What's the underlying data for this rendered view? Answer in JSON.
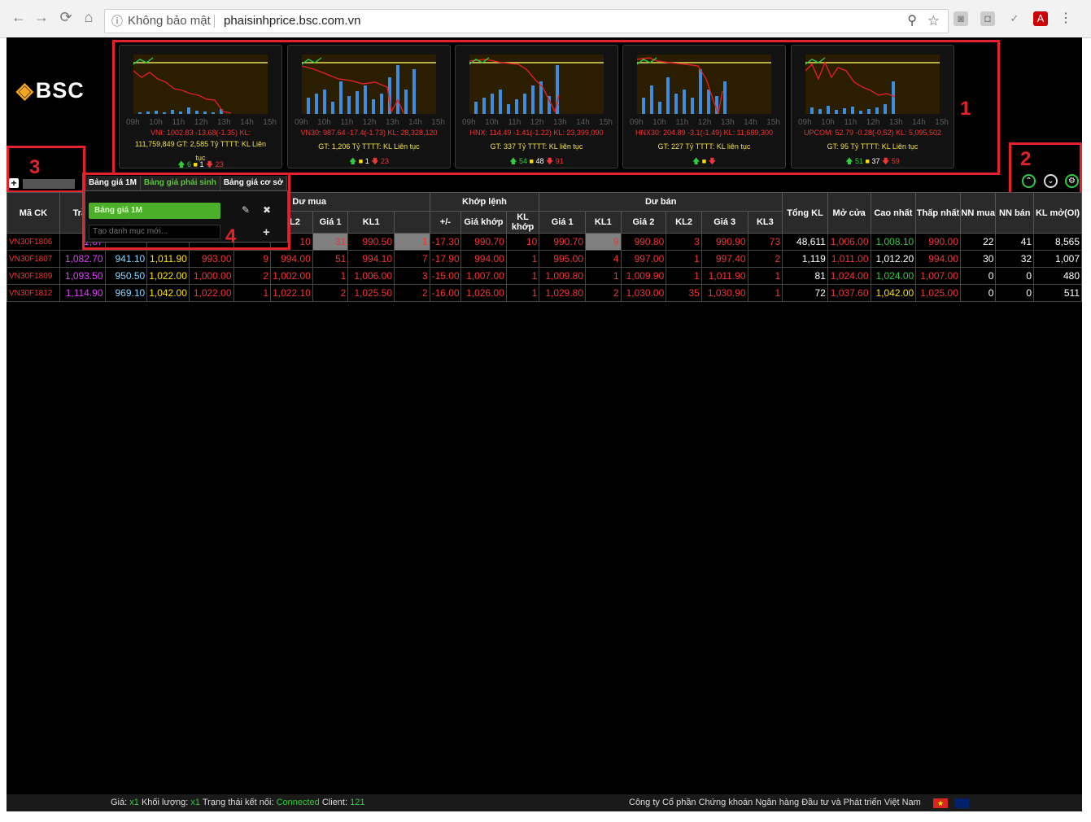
{
  "browser": {
    "insecure_label": "Không bảo mật",
    "url": "phaisinhprice.bsc.com.vn"
  },
  "logo": {
    "text": "BSC"
  },
  "time_axis": [
    "09h",
    "10h",
    "11h",
    "12h",
    "13h",
    "14h",
    "15h"
  ],
  "indices": [
    {
      "name": "VNI",
      "line1": "VNI: 1002.83 -13.68(-1.35) KL:",
      "line2": "111,759,849 GT: 2,585 Tỷ TTTT: KL Liên",
      "line2b": "tục",
      "up": "6",
      "ref": "1",
      "down": "23"
    },
    {
      "name": "VN30",
      "line1": "VN30: 987.64 -17.4(-1.73) KL: 28,328,120",
      "line2": "GT: 1,206 Tỷ TTTT: KL Liên tục",
      "line2b": "",
      "up": "",
      "ref": "1",
      "down": "23"
    },
    {
      "name": "HNX",
      "line1": "HNX: 114.49 -1.41(-1.22) KL: 23,399,090",
      "line2": "GT: 337 Tỷ TTTT: KL liên tục",
      "line2b": "",
      "up": "54",
      "ref": "48",
      "down": "91"
    },
    {
      "name": "HNX30",
      "line1": "HNX30: 204.89 -3.1(-1.49) KL: 11,689,300",
      "line2": "GT: 227 Tỷ TTTT: KL liên tục",
      "line2b": "",
      "up": "",
      "ref": "",
      "down": ""
    },
    {
      "name": "UPCOM",
      "line1": "UPCOM: 52.79 -0.28(-0.52) KL: 5,095,502",
      "line2": "GT: 95 Tỷ TTTT: KL Liên tục",
      "line2b": "",
      "up": "51",
      "ref": "37",
      "down": "59"
    }
  ],
  "annotations": {
    "a1": "1",
    "a2": "2",
    "a3": "3",
    "a4": "4"
  },
  "tabs": [
    "Bảng giá 1M",
    "Bảng giá phái sinh",
    "Bảng giá cơ sở"
  ],
  "dropdown": {
    "item": "Bảng giá 1M",
    "placeholder": "Tạo danh mục mới..."
  },
  "headers": {
    "ma_ck": "Mã CK",
    "tran": "Trần",
    "du_mua": "Dư mua",
    "khop_lenh": "Khớp lệnh",
    "du_ban": "Dư bán",
    "tong_kl": "Tổng KL",
    "mo_cua": "Mở cửa",
    "cao_nhat": "Cao nhất",
    "thap_nhat": "Thấp nhất",
    "nn_mua": "NN mua",
    "nn_ban": "NN bán",
    "kl_mo": "KL mở(OI)",
    "sub": [
      "2",
      "KL2",
      "Giá 1",
      "KL1",
      "+/-",
      "Giá khớp",
      "KL khớp",
      "Giá 1",
      "KL1",
      "Giá 2",
      "KL2",
      "Giá 3",
      "KL3"
    ]
  },
  "rows": [
    [
      "VN30F1806",
      "1,07",
      "",
      "",
      "",
      "",
      "10",
      "31",
      "990.50",
      "1",
      "-17.30",
      "990.70",
      "10",
      "990.70",
      "9",
      "990.80",
      "3",
      "990.90",
      "73",
      "48,611",
      "1,006.00",
      "1,008.10",
      "990.00",
      "22",
      "41",
      "8,565"
    ],
    [
      "VN30F1807",
      "1,082.70",
      "941.10",
      "1,011.90",
      "993.00",
      "9",
      "994.00",
      "51",
      "994.10",
      "7",
      "-17.90",
      "994.00",
      "1",
      "995.00",
      "4",
      "997.00",
      "1",
      "997.40",
      "2",
      "1,119",
      "1,011.00",
      "1,012.20",
      "994.00",
      "30",
      "32",
      "1,007"
    ],
    [
      "VN30F1809",
      "1,093.50",
      "950.50",
      "1,022.00",
      "1,000.00",
      "2",
      "1,002.00",
      "1",
      "1,006.00",
      "3",
      "-15.00",
      "1,007.00",
      "1",
      "1,009.80",
      "1",
      "1,009.90",
      "1",
      "1,011.90",
      "1",
      "81",
      "1,024.00",
      "1,024.00",
      "1,007.00",
      "0",
      "0",
      "480"
    ],
    [
      "VN30F1812",
      "1,114.90",
      "969.10",
      "1,042.00",
      "1,022.00",
      "1",
      "1,022.10",
      "2",
      "1,025.50",
      "2",
      "-16.00",
      "1,026.00",
      "1",
      "1,029.80",
      "2",
      "1,030.00",
      "35",
      "1,030.90",
      "1",
      "72",
      "1,037.60",
      "1,042.00",
      "1,025.00",
      "0",
      "0",
      "511"
    ]
  ],
  "status": {
    "gia_label": "Giá:",
    "gia_val": "x1",
    "kl_label": "Khối lượng:",
    "kl_val": "x1",
    "conn_label": "Trạng thái kết nối:",
    "conn_val": "Connected",
    "client_label": "Client:",
    "client_val": "121",
    "company": "Công ty Cổ phần Chứng khoán Ngân hàng Đầu tư và Phát triển Việt Nam"
  }
}
